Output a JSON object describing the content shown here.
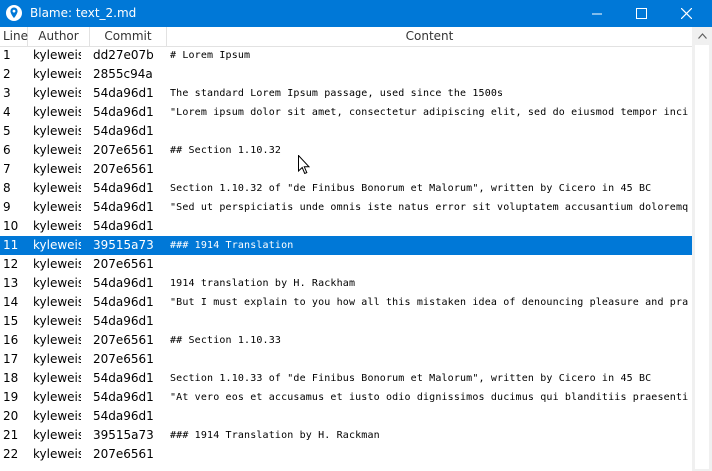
{
  "window": {
    "title": "Blame: text_2.md",
    "icon": "location-pin-icon",
    "controls": [
      "minimize-icon",
      "maximize-icon",
      "close-icon"
    ],
    "accent_color": "#0078d7"
  },
  "table": {
    "columns": {
      "line": "Line",
      "author": "Author",
      "commit": "Commit",
      "content": "Content"
    },
    "selected_line": "11",
    "rows": [
      {
        "line": "1",
        "author": "kyleweish",
        "commit": "dd27e07b",
        "content": "# Lorem Ipsum"
      },
      {
        "line": "2",
        "author": "kyleweish",
        "commit": "2855c94a",
        "content": ""
      },
      {
        "line": "3",
        "author": "kyleweish",
        "commit": "54da96d1",
        "content": "The standard Lorem Ipsum passage, used since the 1500s"
      },
      {
        "line": "4",
        "author": "kyleweish",
        "commit": "54da96d1",
        "content": "\"Lorem ipsum dolor sit amet, consectetur adipiscing elit, sed do eiusmod tempor incidi"
      },
      {
        "line": "5",
        "author": "kyleweish",
        "commit": "54da96d1",
        "content": ""
      },
      {
        "line": "6",
        "author": "kyleweish",
        "commit": "207e6561",
        "content": "## Section 1.10.32"
      },
      {
        "line": "7",
        "author": "kyleweish",
        "commit": "207e6561",
        "content": ""
      },
      {
        "line": "8",
        "author": "kyleweish",
        "commit": "54da96d1",
        "content": "Section 1.10.32 of \"de Finibus Bonorum et Malorum\", written by Cicero in 45 BC"
      },
      {
        "line": "9",
        "author": "kyleweish",
        "commit": "54da96d1",
        "content": "\"Sed ut perspiciatis unde omnis iste natus error sit voluptatem accusantium doloremque"
      },
      {
        "line": "10",
        "author": "kyleweish",
        "commit": "54da96d1",
        "content": ""
      },
      {
        "line": "11",
        "author": "kyleweish",
        "commit": "39515a73",
        "content": "### 1914 Translation"
      },
      {
        "line": "12",
        "author": "kyleweish",
        "commit": "207e6561",
        "content": ""
      },
      {
        "line": "13",
        "author": "kyleweish",
        "commit": "54da96d1",
        "content": "1914 translation by H. Rackham"
      },
      {
        "line": "14",
        "author": "kyleweish",
        "commit": "54da96d1",
        "content": "\"But I must explain to you how all this mistaken idea of denouncing pleasure and prais"
      },
      {
        "line": "15",
        "author": "kyleweish",
        "commit": "54da96d1",
        "content": ""
      },
      {
        "line": "16",
        "author": "kyleweish",
        "commit": "207e6561",
        "content": "## Section 1.10.33"
      },
      {
        "line": "17",
        "author": "kyleweish",
        "commit": "207e6561",
        "content": ""
      },
      {
        "line": "18",
        "author": "kyleweish",
        "commit": "54da96d1",
        "content": "Section 1.10.33 of \"de Finibus Bonorum et Malorum\", written by Cicero in 45 BC"
      },
      {
        "line": "19",
        "author": "kyleweish",
        "commit": "54da96d1",
        "content": "\"At vero eos et accusamus et iusto odio dignissimos ducimus qui blanditiis praesentium"
      },
      {
        "line": "20",
        "author": "kyleweish",
        "commit": "54da96d1",
        "content": ""
      },
      {
        "line": "21",
        "author": "kyleweish",
        "commit": "39515a73",
        "content": "### 1914 Translation by H. Rackman"
      },
      {
        "line": "22",
        "author": "kyleweish",
        "commit": "207e6561",
        "content": ""
      }
    ]
  },
  "scrollbar": {
    "up_icon": "chevron-up-icon"
  }
}
